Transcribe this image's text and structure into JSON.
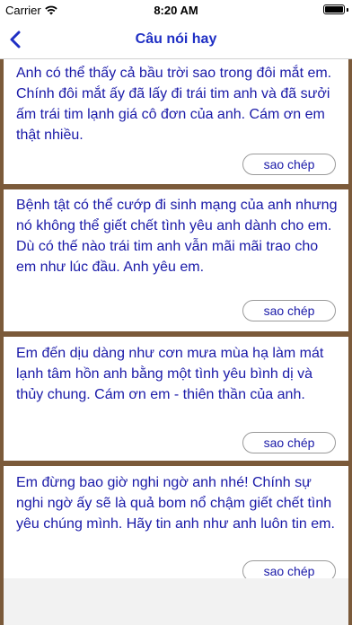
{
  "status": {
    "carrier": "Carrier",
    "time": "8:20 AM",
    "battery_level": 1.0,
    "wifi_icon": "wifi-icon"
  },
  "nav": {
    "title": "Câu nói hay",
    "back_icon": "chevron-left-icon"
  },
  "quotes": [
    {
      "text": "Anh có thể thấy cả bầu trời sao trong đôi mắt em. Chính đôi mắt ấy đã lấy đi trái tim anh và đã sưởi ấm trái tim lạnh giá cô đơn của anh. Cám ơn em thật nhiều.",
      "copy_label": "sao chép"
    },
    {
      "text": "Bệnh tật có thể cướp đi sinh mạng của anh nhưng nó không thể giết chết tình yêu anh dành cho em. Dù có thế nào trái tim anh vẫn mãi mãi trao cho em như lúc đầu. Anh yêu em.",
      "copy_label": "sao chép"
    },
    {
      "text": "Em đến dịu dàng như cơn mưa mùa hạ làm mát lạnh tâm hồn anh bằng một tình yêu bình dị và thủy chung. Cám ơn em - thiên thần của anh.",
      "copy_label": "sao chép"
    },
    {
      "text": "Em đừng bao giờ nghi ngờ anh nhé! Chính sự nghi ngờ ấy sẽ là quả bom nổ chậm giết chết tình yêu chúng mình. Hãy tin anh như anh luôn tin em.",
      "copy_label": "sao chép"
    }
  ],
  "colors": {
    "accent": "#1f2fc4",
    "quote_text": "#1a1aa8",
    "list_background": "#7b5a3a"
  }
}
